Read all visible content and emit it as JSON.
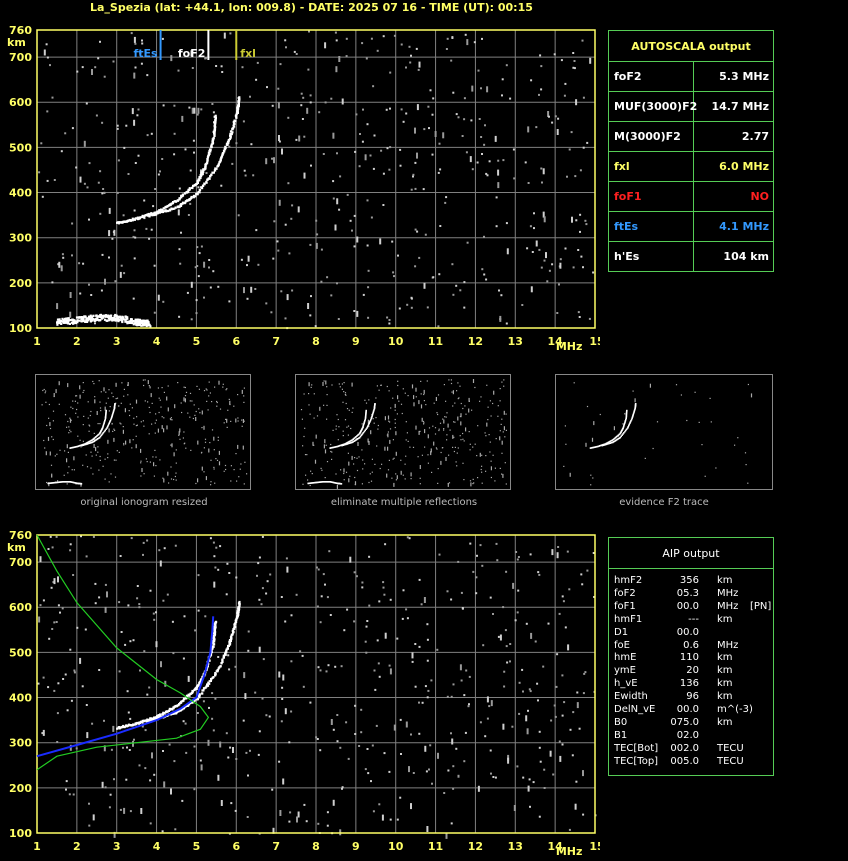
{
  "title": "La_Spezia (lat: +44.1, lon: 009.8) - DATE: 2025 07 16 - TIME (UT): 00:15",
  "colors": {
    "axis": "#ffff66",
    "grid": "#808080",
    "panel": "#55cc55",
    "aip_red": "#ff2020",
    "es_blue": "#3399ff",
    "fxl_yellow": "#cccc33"
  },
  "top_chart": {
    "y_unit": "km",
    "x_unit": "MHz",
    "y_ticks": [
      "760",
      "700",
      "600",
      "500",
      "400",
      "300",
      "200",
      "100"
    ],
    "x_ticks": [
      "1",
      "2",
      "3",
      "4",
      "5",
      "6",
      "7",
      "8",
      "9",
      "10",
      "11",
      "12",
      "13",
      "14",
      "15"
    ],
    "markers": [
      {
        "label": "ftEs",
        "freq": 4.1,
        "color": "#3399ff"
      },
      {
        "label": "foF2",
        "freq": 5.3,
        "color": "#ffffff"
      },
      {
        "label": "fxl",
        "freq": 6.0,
        "color": "#cccc33"
      }
    ]
  },
  "autoscala": {
    "header": "AUTOSCALA output",
    "rows": [
      {
        "label": "foF2",
        "value": "5.3 MHz",
        "lcolor": "#ffffff",
        "vcolor": "#ffffff"
      },
      {
        "label": "MUF(3000)F2",
        "value": "14.7 MHz",
        "lcolor": "#ffffff",
        "vcolor": "#ffffff"
      },
      {
        "label": "M(3000)F2",
        "value": "2.77",
        "lcolor": "#ffffff",
        "vcolor": "#ffffff"
      },
      {
        "label": "fxl",
        "value": "6.0 MHz",
        "lcolor": "#ffff66",
        "vcolor": "#ffff66"
      },
      {
        "label": "foF1",
        "value": "NO",
        "lcolor": "#ff2020",
        "vcolor": "#ff2020"
      },
      {
        "label": "ftEs",
        "value": "4.1 MHz",
        "lcolor": "#3399ff",
        "vcolor": "#3399ff"
      },
      {
        "label": "h'Es",
        "value": "104     km",
        "lcolor": "#ffffff",
        "vcolor": "#ffffff"
      }
    ]
  },
  "thumbnails": [
    {
      "caption": "original ionogram resized"
    },
    {
      "caption": "eliminate multiple reflections"
    },
    {
      "caption": "evidence F2 trace"
    }
  ],
  "aip": {
    "header": "AIP output",
    "rows": [
      {
        "label": "hmF2",
        "value": "356",
        "unit": "km",
        "extra": ""
      },
      {
        "label": "foF2",
        "value": "05.3",
        "unit": "MHz",
        "extra": ""
      },
      {
        "label": "foF1",
        "value": "00.0",
        "unit": "MHz",
        "extra": "[PN]"
      },
      {
        "label": "hmF1",
        "value": "---",
        "unit": "km",
        "extra": ""
      },
      {
        "label": "D1",
        "value": "00.0",
        "unit": "",
        "extra": ""
      },
      {
        "label": "foE",
        "value": "0.6",
        "unit": "MHz",
        "extra": ""
      },
      {
        "label": "hmE",
        "value": "110",
        "unit": "km",
        "extra": ""
      },
      {
        "label": "ymE",
        "value": "20",
        "unit": "km",
        "extra": ""
      },
      {
        "label": "h_vE",
        "value": "136",
        "unit": "km",
        "extra": ""
      },
      {
        "label": "Ewidth",
        "value": "96",
        "unit": "km",
        "extra": ""
      },
      {
        "label": "DelN_vE",
        "value": "00.0",
        "unit": "m^(-3)",
        "extra": ""
      },
      {
        "label": "B0",
        "value": "075.0",
        "unit": "km",
        "extra": ""
      },
      {
        "label": "B1",
        "value": "02.0",
        "unit": "",
        "extra": ""
      },
      {
        "label": "TEC[Bot]",
        "value": "002.0",
        "unit": "TECU",
        "extra": ""
      },
      {
        "label": "TEC[Top]",
        "value": "005.0",
        "unit": "TECU",
        "extra": ""
      }
    ]
  },
  "chart_data": [
    {
      "type": "scatter",
      "title": "",
      "xlabel": "MHz",
      "ylabel": "km",
      "xlim": [
        1,
        15
      ],
      "ylim": [
        100,
        760
      ],
      "grid": true,
      "series": [
        {
          "name": "o-trace",
          "points": [
            [
              3.0,
              335
            ],
            [
              3.5,
              345
            ],
            [
              4.0,
              360
            ],
            [
              4.5,
              385
            ],
            [
              5.0,
              425
            ],
            [
              5.2,
              460
            ],
            [
              5.4,
              520
            ],
            [
              5.45,
              575
            ]
          ]
        },
        {
          "name": "x-trace",
          "points": [
            [
              3.8,
              350
            ],
            [
              4.5,
              370
            ],
            [
              5.0,
              400
            ],
            [
              5.5,
              460
            ],
            [
              5.8,
              520
            ],
            [
              6.0,
              580
            ],
            [
              6.05,
              615
            ]
          ]
        },
        {
          "name": "Es",
          "points": [
            [
              1.5,
              115
            ],
            [
              2.0,
              120
            ],
            [
              2.5,
              125
            ],
            [
              3.0,
              125
            ],
            [
              3.5,
              115
            ],
            [
              3.8,
              112
            ]
          ]
        }
      ]
    },
    {
      "type": "line",
      "title": "",
      "xlabel": "MHz",
      "ylabel": "km",
      "xlim": [
        1,
        15
      ],
      "ylim": [
        100,
        760
      ],
      "grid": true,
      "series": [
        {
          "name": "o-trace",
          "points": [
            [
              3.0,
              335
            ],
            [
              3.5,
              345
            ],
            [
              4.0,
              360
            ],
            [
              4.5,
              385
            ],
            [
              5.0,
              425
            ],
            [
              5.2,
              460
            ],
            [
              5.4,
              520
            ],
            [
              5.45,
              575
            ]
          ]
        },
        {
          "name": "x-trace",
          "points": [
            [
              3.8,
              350
            ],
            [
              4.5,
              370
            ],
            [
              5.0,
              400
            ],
            [
              5.5,
              460
            ],
            [
              5.8,
              520
            ],
            [
              6.0,
              580
            ],
            [
              6.05,
              615
            ]
          ]
        },
        {
          "name": "profile-blue",
          "points": [
            [
              1.0,
              270
            ],
            [
              2.0,
              295
            ],
            [
              3.0,
              320
            ],
            [
              4.0,
              350
            ],
            [
              4.6,
              375
            ],
            [
              5.0,
              400
            ],
            [
              5.2,
              450
            ],
            [
              5.35,
              500
            ],
            [
              5.4,
              550
            ],
            [
              5.42,
              580
            ]
          ]
        },
        {
          "name": "profile-green",
          "points": [
            [
              1.0,
              760
            ],
            [
              1.5,
              680
            ],
            [
              2.0,
              610
            ],
            [
              3.0,
              510
            ],
            [
              4.0,
              440
            ],
            [
              4.6,
              410
            ],
            [
              5.1,
              380
            ],
            [
              5.3,
              356
            ],
            [
              5.1,
              330
            ],
            [
              4.5,
              310
            ],
            [
              3.5,
              300
            ],
            [
              2.5,
              290
            ],
            [
              1.5,
              270
            ],
            [
              1.0,
              240
            ]
          ]
        }
      ]
    }
  ]
}
